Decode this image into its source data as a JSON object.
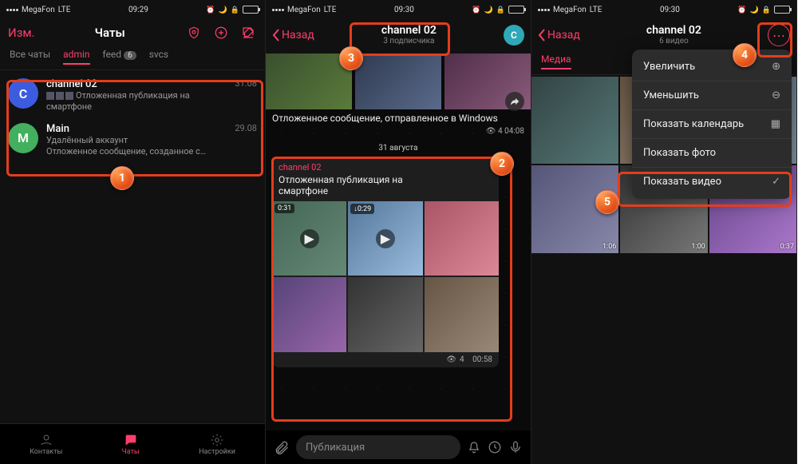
{
  "status": {
    "carrier": "MegaFon",
    "network": "LTE",
    "time1": "09:29",
    "time2": "09:30",
    "time3": "09:30"
  },
  "screen1": {
    "edit": "Изм.",
    "title": "Чаты",
    "tabs": {
      "all": "Все чаты",
      "admin": "admin",
      "feed": "feed",
      "feed_badge": "6",
      "svcs": "svcs"
    },
    "chats": [
      {
        "letter": "C",
        "name": "channel 02",
        "date": "31.08",
        "msg_prefix": "Отложенная публикация на",
        "msg_line2": "смартфоне"
      },
      {
        "letter": "M",
        "name": "Main",
        "date": "29.08",
        "sub1": "Удалённый аккаунт",
        "sub2": "Отложенное сообщение, созданное с…"
      }
    ],
    "tabbar": {
      "contacts": "Контакты",
      "chats": "Чаты",
      "settings": "Настройки"
    }
  },
  "screen2": {
    "back": "Назад",
    "title": "channel 02",
    "subtitle": "3 подписчика",
    "avatar_letter": "C",
    "msg1_text": "Отложенное сообщение, отправленное в Windows",
    "msg1_views": "4",
    "msg1_time": "04:08",
    "date_sep": "31 августа",
    "card_channel": "channel 02",
    "card_text_l1": "Отложенная публикация на",
    "card_text_l2": "смартфоне",
    "durations": {
      "d1": "0:31",
      "d2": "0:29"
    },
    "card_views": "4",
    "card_time": "00:58",
    "composer_placeholder": "Публикация"
  },
  "screen3": {
    "back": "Назад",
    "title": "channel 02",
    "subtitle": "6 видео",
    "tab_media": "Медиа",
    "menu": {
      "zoom_in": "Увеличить",
      "zoom_out": "Уменьшить",
      "calendar": "Показать календарь",
      "photo": "Показать фото",
      "video": "Показать видео"
    },
    "durations": {
      "d1": "1:06",
      "d2": "1:00",
      "d3": "0:37"
    }
  },
  "badges": {
    "n1": "1",
    "n2": "2",
    "n3": "3",
    "n4": "4",
    "n5": "5"
  }
}
